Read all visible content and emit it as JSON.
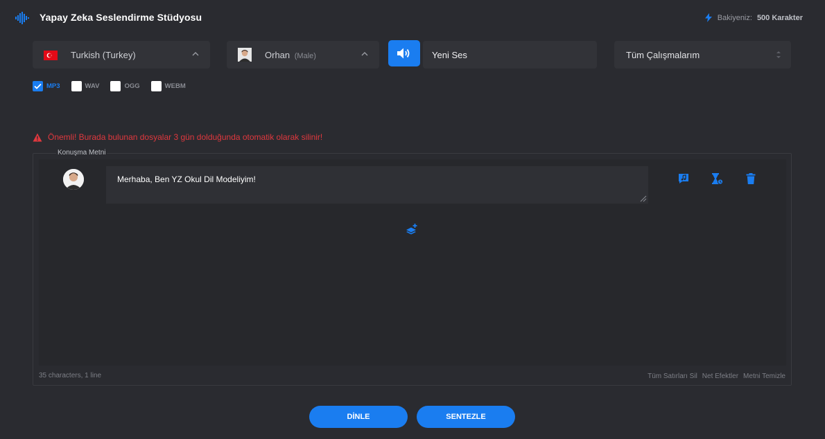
{
  "header": {
    "title": "Yapay Zeka Seslendirme Stüdyosu",
    "balance_label": "Bakiyeniz:",
    "balance_value": "500 Karakter"
  },
  "controls": {
    "language": {
      "selected": "Turkish (Turkey)"
    },
    "voice": {
      "name": "Orhan",
      "gender": "(Male)"
    },
    "project_name": "Yeni Ses",
    "works": {
      "selected": "Tüm Çalışmalarım"
    }
  },
  "formats": [
    {
      "label": "MP3",
      "checked": true
    },
    {
      "label": "WAV",
      "checked": false
    },
    {
      "label": "OGG",
      "checked": false
    },
    {
      "label": "WEBM",
      "checked": false
    }
  ],
  "warning": "Önemli! Burada bulunan dosyalar 3 gün dolduğunda otomatik olarak silinir!",
  "editor": {
    "legend": "Konuşma Metni",
    "lines": [
      {
        "text": "Merhaba, Ben YZ Okul Dil Modeliyim!"
      }
    ],
    "status": "35 characters, 1 line",
    "links": [
      "Tüm Satırları Sil",
      "Net Efektler",
      "Metni Temizle"
    ]
  },
  "actions": {
    "listen_label": "DİNLE",
    "synthesize_label": "SENTEZLE"
  },
  "colors": {
    "accent": "#1a7df0",
    "background": "#2a2b30",
    "warning": "#e0383e"
  }
}
